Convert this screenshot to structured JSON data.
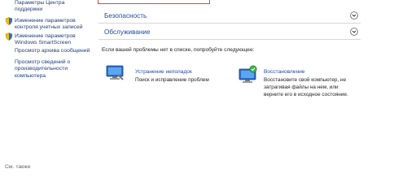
{
  "sidebar": {
    "items": [
      {
        "label_lines": [
          "Параметры Центра",
          "поддержки"
        ],
        "icon": "none"
      },
      {
        "label_lines": [
          "Изменение параметров",
          "контроля учетных записей"
        ],
        "icon": "shield-icon"
      },
      {
        "label_lines": [
          "Изменение параметров",
          "Windows SmartScreen"
        ],
        "icon": "shield-icon"
      },
      {
        "label_lines": [
          "Просмотр архива сообщений"
        ],
        "icon": "none"
      },
      {
        "label_lines": [
          "Просмотр сведений о",
          "производительности",
          "компьютера"
        ],
        "icon": "none"
      }
    ],
    "see_also": "См. также"
  },
  "sections": [
    {
      "title": "Безопасность",
      "icon": "chevron-down-icon"
    },
    {
      "title": "Обслуживание",
      "icon": "chevron-down-icon"
    }
  ],
  "prompt": "Если вашей проблемы нет в списке, попробуйте следующее:",
  "tools": [
    {
      "title": "Устранение неполадок",
      "desc_lines": [
        "Поиск и исправление проблем"
      ],
      "icon": "troubleshoot-icon"
    },
    {
      "title": "Восстановление",
      "desc_lines": [
        "Восстановите свой компьютер, не",
        "затрагивая файлы на нем, или",
        "верните его в исходное состояние."
      ],
      "icon": "recovery-icon"
    }
  ]
}
